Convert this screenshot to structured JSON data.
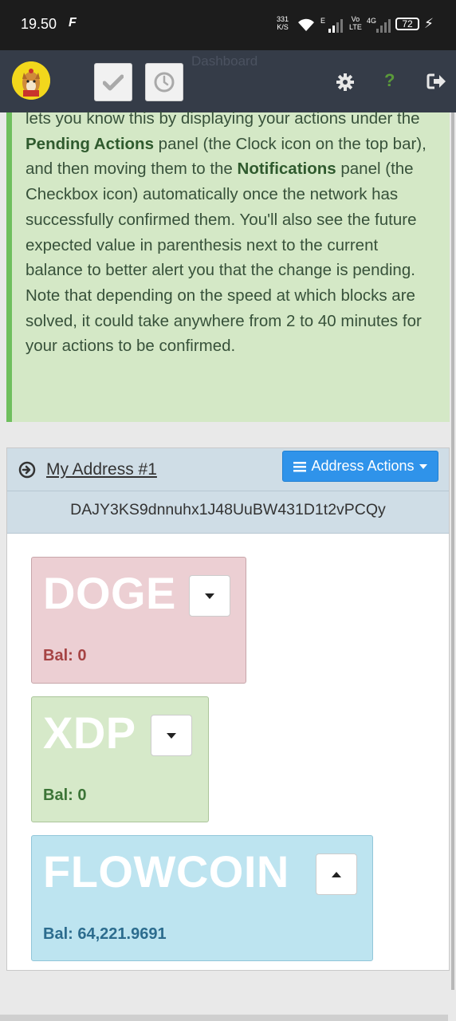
{
  "status_bar": {
    "time": "19.50",
    "flash_icon": "F",
    "speed_value": "331",
    "speed_unit": "K/S",
    "network_e": "E",
    "volte_top": "Vo",
    "volte_bottom": "LTE",
    "network_4g": "4G",
    "battery": "72"
  },
  "topbar": {
    "ghost_title": "Dashboard",
    "help_label": "?"
  },
  "info_panel": {
    "line1": "lets you know this by displaying your actions under the ",
    "pending_strong": "Pending Actions",
    "line2": " panel (the Clock icon on the top bar), and then moving them to the ",
    "notifications_strong": "Notifications",
    "line3": " panel (the Checkbox icon) automatically once the network has successfully confirmed them. You'll also see the future expected value in parenthesis next to the current balance to better alert you that the change is pending. Note that depending on the speed at which blocks are solved, it could take anywhere from 2 to 40 minutes for your actions to be confirmed."
  },
  "address": {
    "name": "My Address #1",
    "actions_label": "Address Actions",
    "value": "DAJY3KS9dnnuhx1J48UuBW431D1t2vPCQy"
  },
  "coins": [
    {
      "symbol": "DOGE",
      "balance": "Bal: 0",
      "color": "#a64444"
    },
    {
      "symbol": "XDP",
      "balance": "Bal: 0",
      "color": "#3c7437"
    },
    {
      "symbol": "FLOWCOIN",
      "balance": "Bal: 64,221.9691",
      "color": "#2c6c8e"
    }
  ]
}
